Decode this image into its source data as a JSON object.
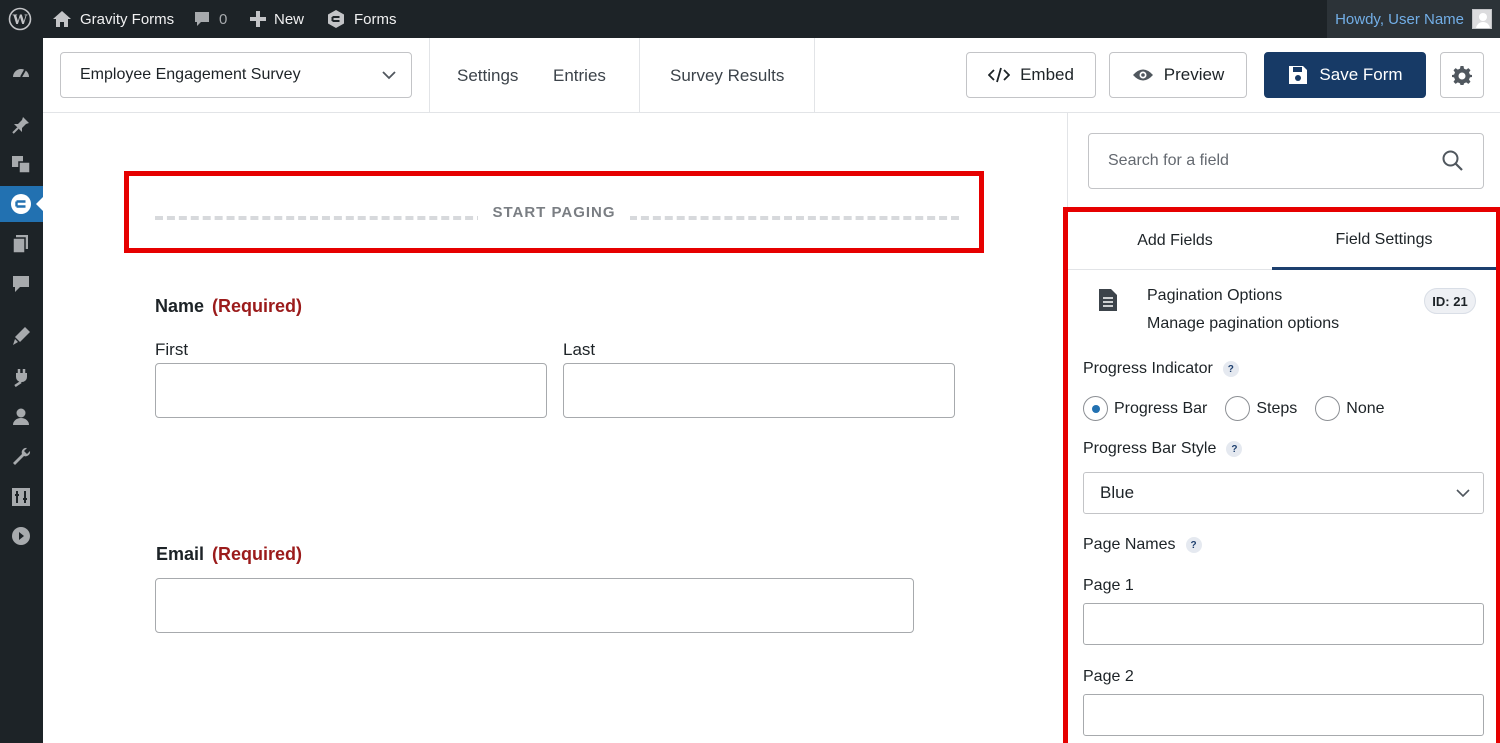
{
  "admin_bar": {
    "site_name": "Gravity Forms",
    "comments_count": "0",
    "new_label": "New",
    "forms_label": "Forms",
    "howdy": "Howdy, User Name"
  },
  "toolbar": {
    "form_name": "Employee Engagement Survey",
    "links": [
      "Settings",
      "Entries",
      "Survey Results"
    ],
    "embed_label": "Embed",
    "preview_label": "Preview",
    "save_label": "Save Form"
  },
  "canvas": {
    "start_paging": "START PAGING",
    "name_field": {
      "label": "Name",
      "required": "(Required)",
      "first": "First",
      "last": "Last"
    },
    "email_field": {
      "label": "Email",
      "required": "(Required)"
    }
  },
  "panel": {
    "search_placeholder": "Search for a field",
    "tabs": [
      "Add Fields",
      "Field Settings"
    ],
    "active_tab": "Field Settings",
    "field_title": "Pagination Options",
    "field_desc": "Manage pagination options",
    "field_id": "ID: 21",
    "progress_indicator_label": "Progress Indicator",
    "progress_options": [
      "Progress Bar",
      "Steps",
      "None"
    ],
    "progress_selected": "Progress Bar",
    "progress_bar_style_label": "Progress Bar Style",
    "progress_bar_style_value": "Blue",
    "page_names_label": "Page Names",
    "pages": [
      "Page 1",
      "Page 2"
    ]
  },
  "colors": {
    "highlight_red": "#e60000",
    "primary_navy": "#173a66",
    "required_red": "#9b1b1b",
    "admin_dark": "#1d2327"
  }
}
